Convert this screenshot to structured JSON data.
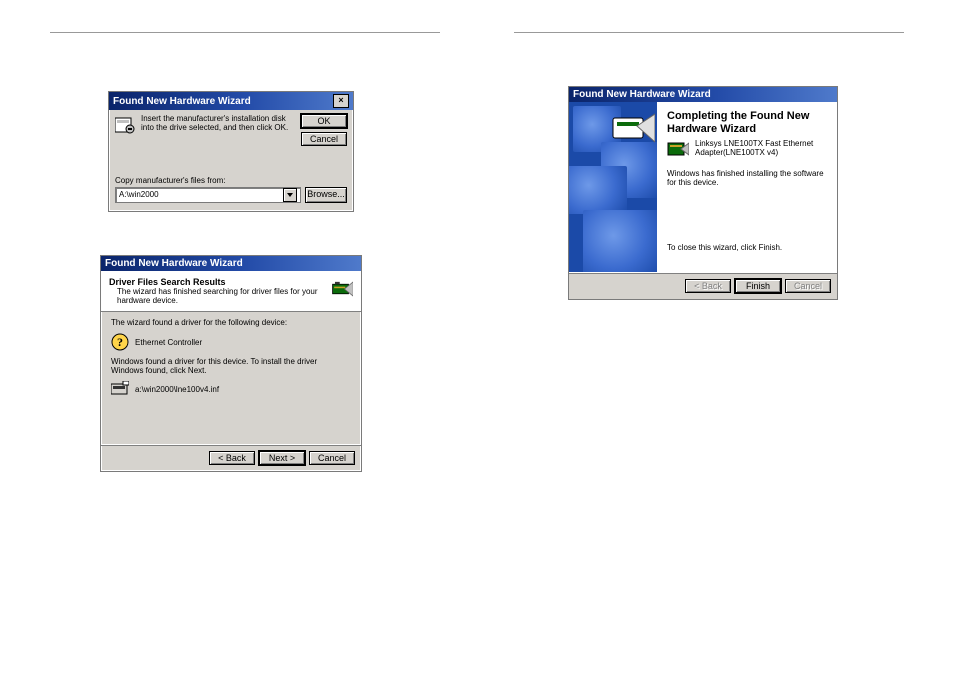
{
  "wiz1": {
    "title": "Found New Hardware Wizard",
    "instruction": "Insert the manufacturer's installation disk into the drive selected, and then click OK.",
    "ok": "OK",
    "cancel": "Cancel",
    "copy_label": "Copy manufacturer's files from:",
    "path": "A:\\win2000",
    "browse": "Browse..."
  },
  "wiz2": {
    "title": "Found New Hardware Wizard",
    "head_title": "Driver Files Search Results",
    "head_sub": "The wizard has finished searching for driver files for your hardware device.",
    "line1": "The wizard found a driver for the following device:",
    "device": "Ethernet Controller",
    "line2": "Windows found a driver for this device. To install the driver Windows found, click Next.",
    "path": "a:\\win2000\\lne100v4.inf",
    "back": "< Back",
    "next": "Next >",
    "cancel": "Cancel"
  },
  "wiz3": {
    "title": "Found New Hardware Wizard",
    "heading": "Completing the Found New Hardware Wizard",
    "device": "Linksys LNE100TX Fast Ethernet Adapter(LNE100TX v4)",
    "msg": "Windows has finished installing the software for this device.",
    "closing": "To close this wizard, click Finish.",
    "back": "< Back",
    "finish": "Finish",
    "cancel": "Cancel"
  }
}
